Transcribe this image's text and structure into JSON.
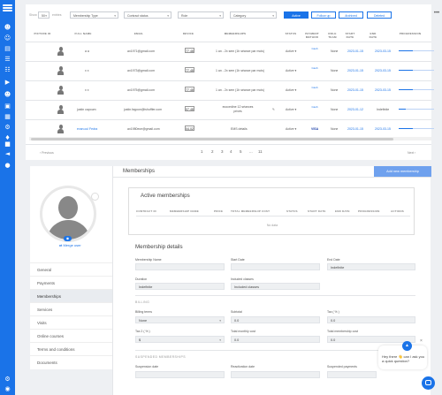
{
  "rail": {
    "icons": [
      "menu-icon",
      "user-icon",
      "users-icon",
      "card-icon",
      "list-icon",
      "contacts-icon",
      "video-icon",
      "user-settings-icon",
      "clipboard-icon",
      "calendar-icon",
      "settings-icon",
      "tag-icon",
      "bag-icon",
      "megaphone-icon",
      "chat-icon",
      "gear-icon",
      "avatar-icon"
    ]
  },
  "filters": {
    "show_label": "Show",
    "show_value": "50",
    "entries_label": "entries",
    "membership_type": "Membership Type",
    "contract_status": "Contract status",
    "role": "Role",
    "category": "Category",
    "active_btn": "Active",
    "followup_btn": "Follow up",
    "archived_btn": "Archived",
    "deleted_btn": "Deleted",
    "more": "•••"
  },
  "table": {
    "headers": [
      "PICTURE ID",
      "FULL NAME",
      "EMAIL",
      "DEVICE",
      "MEMBERSHIPS",
      "STATUS",
      "PAYMENT METHOD",
      "ROLE TEAM",
      "START DATE",
      "END DATE",
      "PROGRESSION"
    ],
    "rows": [
      {
        "name": "a a",
        "email": "ax1971@gmail.com",
        "phone": "77.48",
        "membership": "1 an - 2x sem (1h séance par mois)",
        "status": "Active ▾",
        "pay": "Cash",
        "role": "None",
        "start": "2023-01-15",
        "end": "2023-03-15",
        "progress": 0.4
      },
      {
        "name": "x x",
        "email": "ax1973@gmail.com",
        "phone": "77.48",
        "membership": "1 an - 2x sem (1h séance par mois)",
        "status": "Active ▾",
        "pay": "Cash",
        "role": "None",
        "start": "2023-01-15",
        "end": "2023-03-15",
        "progress": 0.4
      },
      {
        "name": "x x",
        "email": "ax1975@gmail.com",
        "phone": "77.48",
        "membership": "1 an - 2x sem (1h séance par mois)",
        "status": "Active ▾",
        "pay": "Cash",
        "role": "None",
        "start": "2023-01-15",
        "end": "2023-03-15",
        "progress": 0.4
      },
      {
        "name": "justin capoum",
        "email": "justin.fagoon@ishuffler.com",
        "phone": "07.48",
        "membership": "ecocedine 12 séances privés",
        "status": "Active ▾",
        "pay": "Cash",
        "role": "None",
        "start": "2023-01-12",
        "end": "Indefinite",
        "progress": 0.2
      },
      {
        "name": "evan.cul Fedra",
        "email": "ax1980ece@gmail.com",
        "phone": "04.02",
        "membership": "EMS details",
        "status": "Active ▾",
        "pay": "VISA",
        "role": "None",
        "start": "2023-01-15",
        "end": "2023-03-15",
        "progress": 0.4
      }
    ]
  },
  "pager": {
    "previous": "‹ Previous",
    "pages": [
      "1",
      "2",
      "3",
      "4",
      "5",
      "...",
      "11"
    ],
    "next": "Next ›"
  },
  "profile": {
    "merge_label": "Merge user",
    "camera_icon": "camera-icon",
    "menu": [
      "General",
      "Payments",
      "Memberships",
      "Services",
      "Visits",
      "Online courses",
      "Terms and conditions",
      "Documents"
    ]
  },
  "memberships": {
    "title": "Memberships",
    "add_btn": "Add new membership",
    "active_title": "Active memberships",
    "active_headers": [
      "CONTRACT ID",
      "MEMBERSHIP NAME",
      "PRICE",
      "TOTAL MEMBERSHIP COST",
      "STATUS",
      "START DATE",
      "END DATE",
      "PROGRESSION",
      "ACTIONS"
    ],
    "no_data": "No data",
    "details_title": "Membership details",
    "fields": {
      "name_label": "Membership Name",
      "start_label": "Start Date",
      "end_label": "End Date",
      "end_value": "Indefinite",
      "duration_label": "Duration",
      "duration_value": "Indefinite",
      "included_label": "Included classes",
      "included_value": "Included classes"
    },
    "billing_title": "BILLING",
    "billing": {
      "terms_label": "Billing terms",
      "terms_value": "None",
      "subtotal_label": "Subtotal",
      "subtotal_value": "0.0",
      "tax_label": "Tax ( % )",
      "tax_value": "0.0",
      "tax2_label": "Tax 2 ( % )",
      "tax2_value": "$",
      "total_monthly_label": "Total monthly cost",
      "total_monthly_value": "0.0",
      "total_membership_label": "Total membership cost",
      "total_membership_value": "0.0"
    },
    "suspended_title": "SUSPENDED MEMBERSHIPS",
    "suspended": {
      "suspension_label": "Suspension date",
      "reactivation_label": "Reactivation date",
      "payments_label": "Suspended payments"
    }
  },
  "chat": {
    "message": "Hey there 👋 can I ask you a quick question?",
    "close": "×"
  }
}
